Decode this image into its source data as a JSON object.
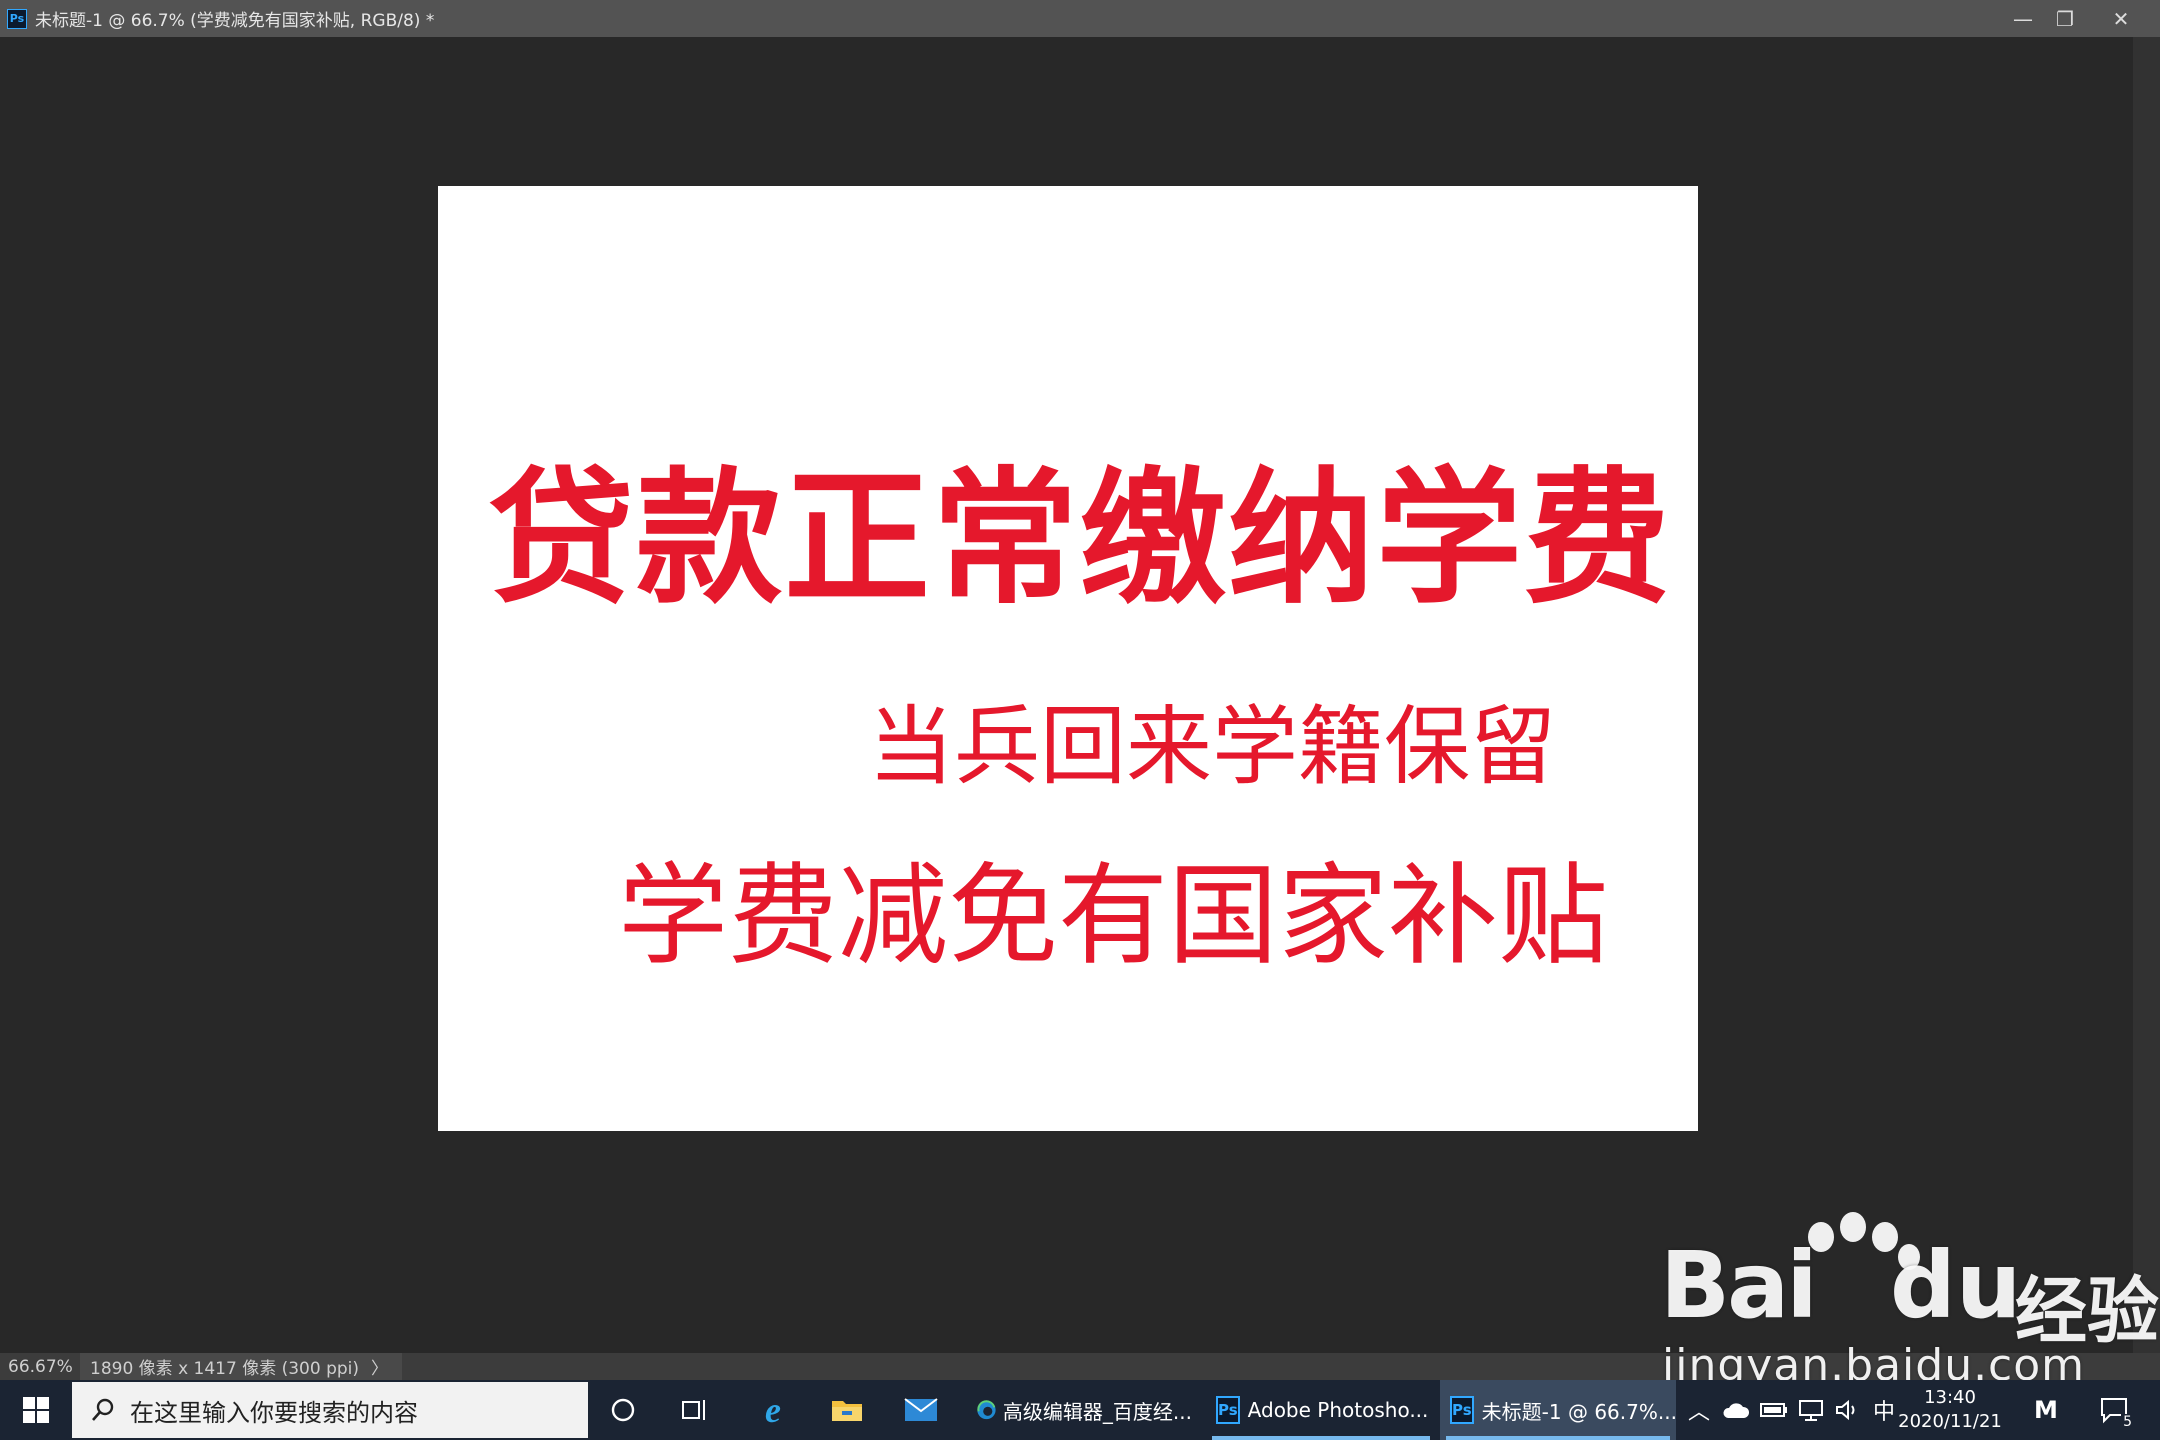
{
  "window": {
    "app_badge": "Ps",
    "title": "未标题-1 @ 66.7% (学费减免有国家补贴, RGB/8) *",
    "minimize_glyph": "—",
    "restore_glyph": "❐",
    "close_glyph": "✕"
  },
  "document": {
    "background": "#ffffff",
    "text_color": "#e5182c",
    "lines": [
      "贷款正常缴纳学费",
      "当兵回来学籍保留",
      "学费减免有国家补贴"
    ]
  },
  "statusbar": {
    "zoom": "66.67%",
    "doc_info": "1890 像素 x 1417 像素 (300 ppi)",
    "arrow": "〉"
  },
  "watermark": {
    "brand_bai": "Bai",
    "brand_du": "du",
    "brand_cn": "经验",
    "url": "jingyan.baidu.com"
  },
  "taskbar": {
    "search_placeholder": "在这里输入你要搜索的内容",
    "apps": [
      {
        "label": "高级编辑器_百度经...",
        "icon": "edge-icon"
      },
      {
        "label": "Adobe Photosho...",
        "icon": "photoshop-icon"
      },
      {
        "label": "未标题-1 @ 66.7%...",
        "icon": "photoshop-icon",
        "active": true
      }
    ],
    "ime": "中",
    "time": "13:40",
    "date": "2020/11/21",
    "notification_count": "5",
    "colors": {
      "taskbar": "#1b2433",
      "accent": "#76b9ed"
    }
  }
}
